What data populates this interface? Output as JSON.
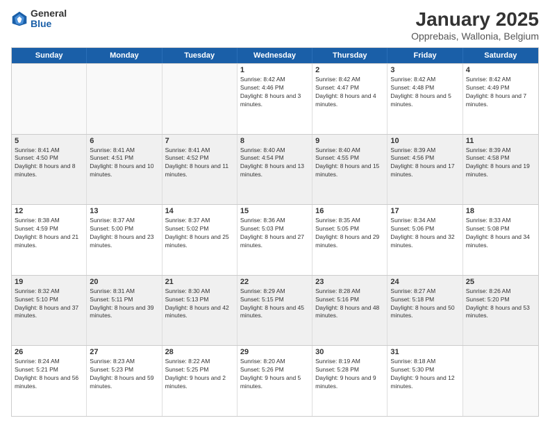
{
  "logo": {
    "general": "General",
    "blue": "Blue"
  },
  "title": "January 2025",
  "subtitle": "Opprebais, Wallonia, Belgium",
  "days": [
    "Sunday",
    "Monday",
    "Tuesday",
    "Wednesday",
    "Thursday",
    "Friday",
    "Saturday"
  ],
  "weeks": [
    [
      {
        "day": "",
        "empty": true
      },
      {
        "day": "",
        "empty": true
      },
      {
        "day": "",
        "empty": true
      },
      {
        "day": "1",
        "sunrise": "Sunrise: 8:42 AM",
        "sunset": "Sunset: 4:46 PM",
        "daylight": "Daylight: 8 hours and 3 minutes."
      },
      {
        "day": "2",
        "sunrise": "Sunrise: 8:42 AM",
        "sunset": "Sunset: 4:47 PM",
        "daylight": "Daylight: 8 hours and 4 minutes."
      },
      {
        "day": "3",
        "sunrise": "Sunrise: 8:42 AM",
        "sunset": "Sunset: 4:48 PM",
        "daylight": "Daylight: 8 hours and 5 minutes."
      },
      {
        "day": "4",
        "sunrise": "Sunrise: 8:42 AM",
        "sunset": "Sunset: 4:49 PM",
        "daylight": "Daylight: 8 hours and 7 minutes."
      }
    ],
    [
      {
        "day": "5",
        "sunrise": "Sunrise: 8:41 AM",
        "sunset": "Sunset: 4:50 PM",
        "daylight": "Daylight: 8 hours and 8 minutes."
      },
      {
        "day": "6",
        "sunrise": "Sunrise: 8:41 AM",
        "sunset": "Sunset: 4:51 PM",
        "daylight": "Daylight: 8 hours and 10 minutes."
      },
      {
        "day": "7",
        "sunrise": "Sunrise: 8:41 AM",
        "sunset": "Sunset: 4:52 PM",
        "daylight": "Daylight: 8 hours and 11 minutes."
      },
      {
        "day": "8",
        "sunrise": "Sunrise: 8:40 AM",
        "sunset": "Sunset: 4:54 PM",
        "daylight": "Daylight: 8 hours and 13 minutes."
      },
      {
        "day": "9",
        "sunrise": "Sunrise: 8:40 AM",
        "sunset": "Sunset: 4:55 PM",
        "daylight": "Daylight: 8 hours and 15 minutes."
      },
      {
        "day": "10",
        "sunrise": "Sunrise: 8:39 AM",
        "sunset": "Sunset: 4:56 PM",
        "daylight": "Daylight: 8 hours and 17 minutes."
      },
      {
        "day": "11",
        "sunrise": "Sunrise: 8:39 AM",
        "sunset": "Sunset: 4:58 PM",
        "daylight": "Daylight: 8 hours and 19 minutes."
      }
    ],
    [
      {
        "day": "12",
        "sunrise": "Sunrise: 8:38 AM",
        "sunset": "Sunset: 4:59 PM",
        "daylight": "Daylight: 8 hours and 21 minutes."
      },
      {
        "day": "13",
        "sunrise": "Sunrise: 8:37 AM",
        "sunset": "Sunset: 5:00 PM",
        "daylight": "Daylight: 8 hours and 23 minutes."
      },
      {
        "day": "14",
        "sunrise": "Sunrise: 8:37 AM",
        "sunset": "Sunset: 5:02 PM",
        "daylight": "Daylight: 8 hours and 25 minutes."
      },
      {
        "day": "15",
        "sunrise": "Sunrise: 8:36 AM",
        "sunset": "Sunset: 5:03 PM",
        "daylight": "Daylight: 8 hours and 27 minutes."
      },
      {
        "day": "16",
        "sunrise": "Sunrise: 8:35 AM",
        "sunset": "Sunset: 5:05 PM",
        "daylight": "Daylight: 8 hours and 29 minutes."
      },
      {
        "day": "17",
        "sunrise": "Sunrise: 8:34 AM",
        "sunset": "Sunset: 5:06 PM",
        "daylight": "Daylight: 8 hours and 32 minutes."
      },
      {
        "day": "18",
        "sunrise": "Sunrise: 8:33 AM",
        "sunset": "Sunset: 5:08 PM",
        "daylight": "Daylight: 8 hours and 34 minutes."
      }
    ],
    [
      {
        "day": "19",
        "sunrise": "Sunrise: 8:32 AM",
        "sunset": "Sunset: 5:10 PM",
        "daylight": "Daylight: 8 hours and 37 minutes."
      },
      {
        "day": "20",
        "sunrise": "Sunrise: 8:31 AM",
        "sunset": "Sunset: 5:11 PM",
        "daylight": "Daylight: 8 hours and 39 minutes."
      },
      {
        "day": "21",
        "sunrise": "Sunrise: 8:30 AM",
        "sunset": "Sunset: 5:13 PM",
        "daylight": "Daylight: 8 hours and 42 minutes."
      },
      {
        "day": "22",
        "sunrise": "Sunrise: 8:29 AM",
        "sunset": "Sunset: 5:15 PM",
        "daylight": "Daylight: 8 hours and 45 minutes."
      },
      {
        "day": "23",
        "sunrise": "Sunrise: 8:28 AM",
        "sunset": "Sunset: 5:16 PM",
        "daylight": "Daylight: 8 hours and 48 minutes."
      },
      {
        "day": "24",
        "sunrise": "Sunrise: 8:27 AM",
        "sunset": "Sunset: 5:18 PM",
        "daylight": "Daylight: 8 hours and 50 minutes."
      },
      {
        "day": "25",
        "sunrise": "Sunrise: 8:26 AM",
        "sunset": "Sunset: 5:20 PM",
        "daylight": "Daylight: 8 hours and 53 minutes."
      }
    ],
    [
      {
        "day": "26",
        "sunrise": "Sunrise: 8:24 AM",
        "sunset": "Sunset: 5:21 PM",
        "daylight": "Daylight: 8 hours and 56 minutes."
      },
      {
        "day": "27",
        "sunrise": "Sunrise: 8:23 AM",
        "sunset": "Sunset: 5:23 PM",
        "daylight": "Daylight: 8 hours and 59 minutes."
      },
      {
        "day": "28",
        "sunrise": "Sunrise: 8:22 AM",
        "sunset": "Sunset: 5:25 PM",
        "daylight": "Daylight: 9 hours and 2 minutes."
      },
      {
        "day": "29",
        "sunrise": "Sunrise: 8:20 AM",
        "sunset": "Sunset: 5:26 PM",
        "daylight": "Daylight: 9 hours and 5 minutes."
      },
      {
        "day": "30",
        "sunrise": "Sunrise: 8:19 AM",
        "sunset": "Sunset: 5:28 PM",
        "daylight": "Daylight: 9 hours and 9 minutes."
      },
      {
        "day": "31",
        "sunrise": "Sunrise: 8:18 AM",
        "sunset": "Sunset: 5:30 PM",
        "daylight": "Daylight: 9 hours and 12 minutes."
      },
      {
        "day": "",
        "empty": true
      }
    ]
  ]
}
